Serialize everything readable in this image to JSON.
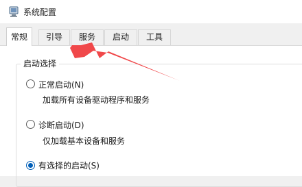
{
  "window": {
    "title": "系统配置"
  },
  "tabs": [
    {
      "label": "常规",
      "active": true
    },
    {
      "label": "引导",
      "active": false
    },
    {
      "label": "服务",
      "active": false
    },
    {
      "label": "启动",
      "active": false
    },
    {
      "label": "工具",
      "active": false
    }
  ],
  "startup_group": {
    "legend": "启动选择",
    "options": [
      {
        "label": "正常启动(N)",
        "description": "加载所有设备驱动程序和服务",
        "checked": false
      },
      {
        "label": "诊断启动(D)",
        "description": "仅加载基本设备和服务",
        "checked": false
      },
      {
        "label": "有选择的启动(S)",
        "checked": true
      }
    ]
  },
  "colors": {
    "accent": "#005fb8",
    "annotation_arrow": "#f0484a"
  }
}
